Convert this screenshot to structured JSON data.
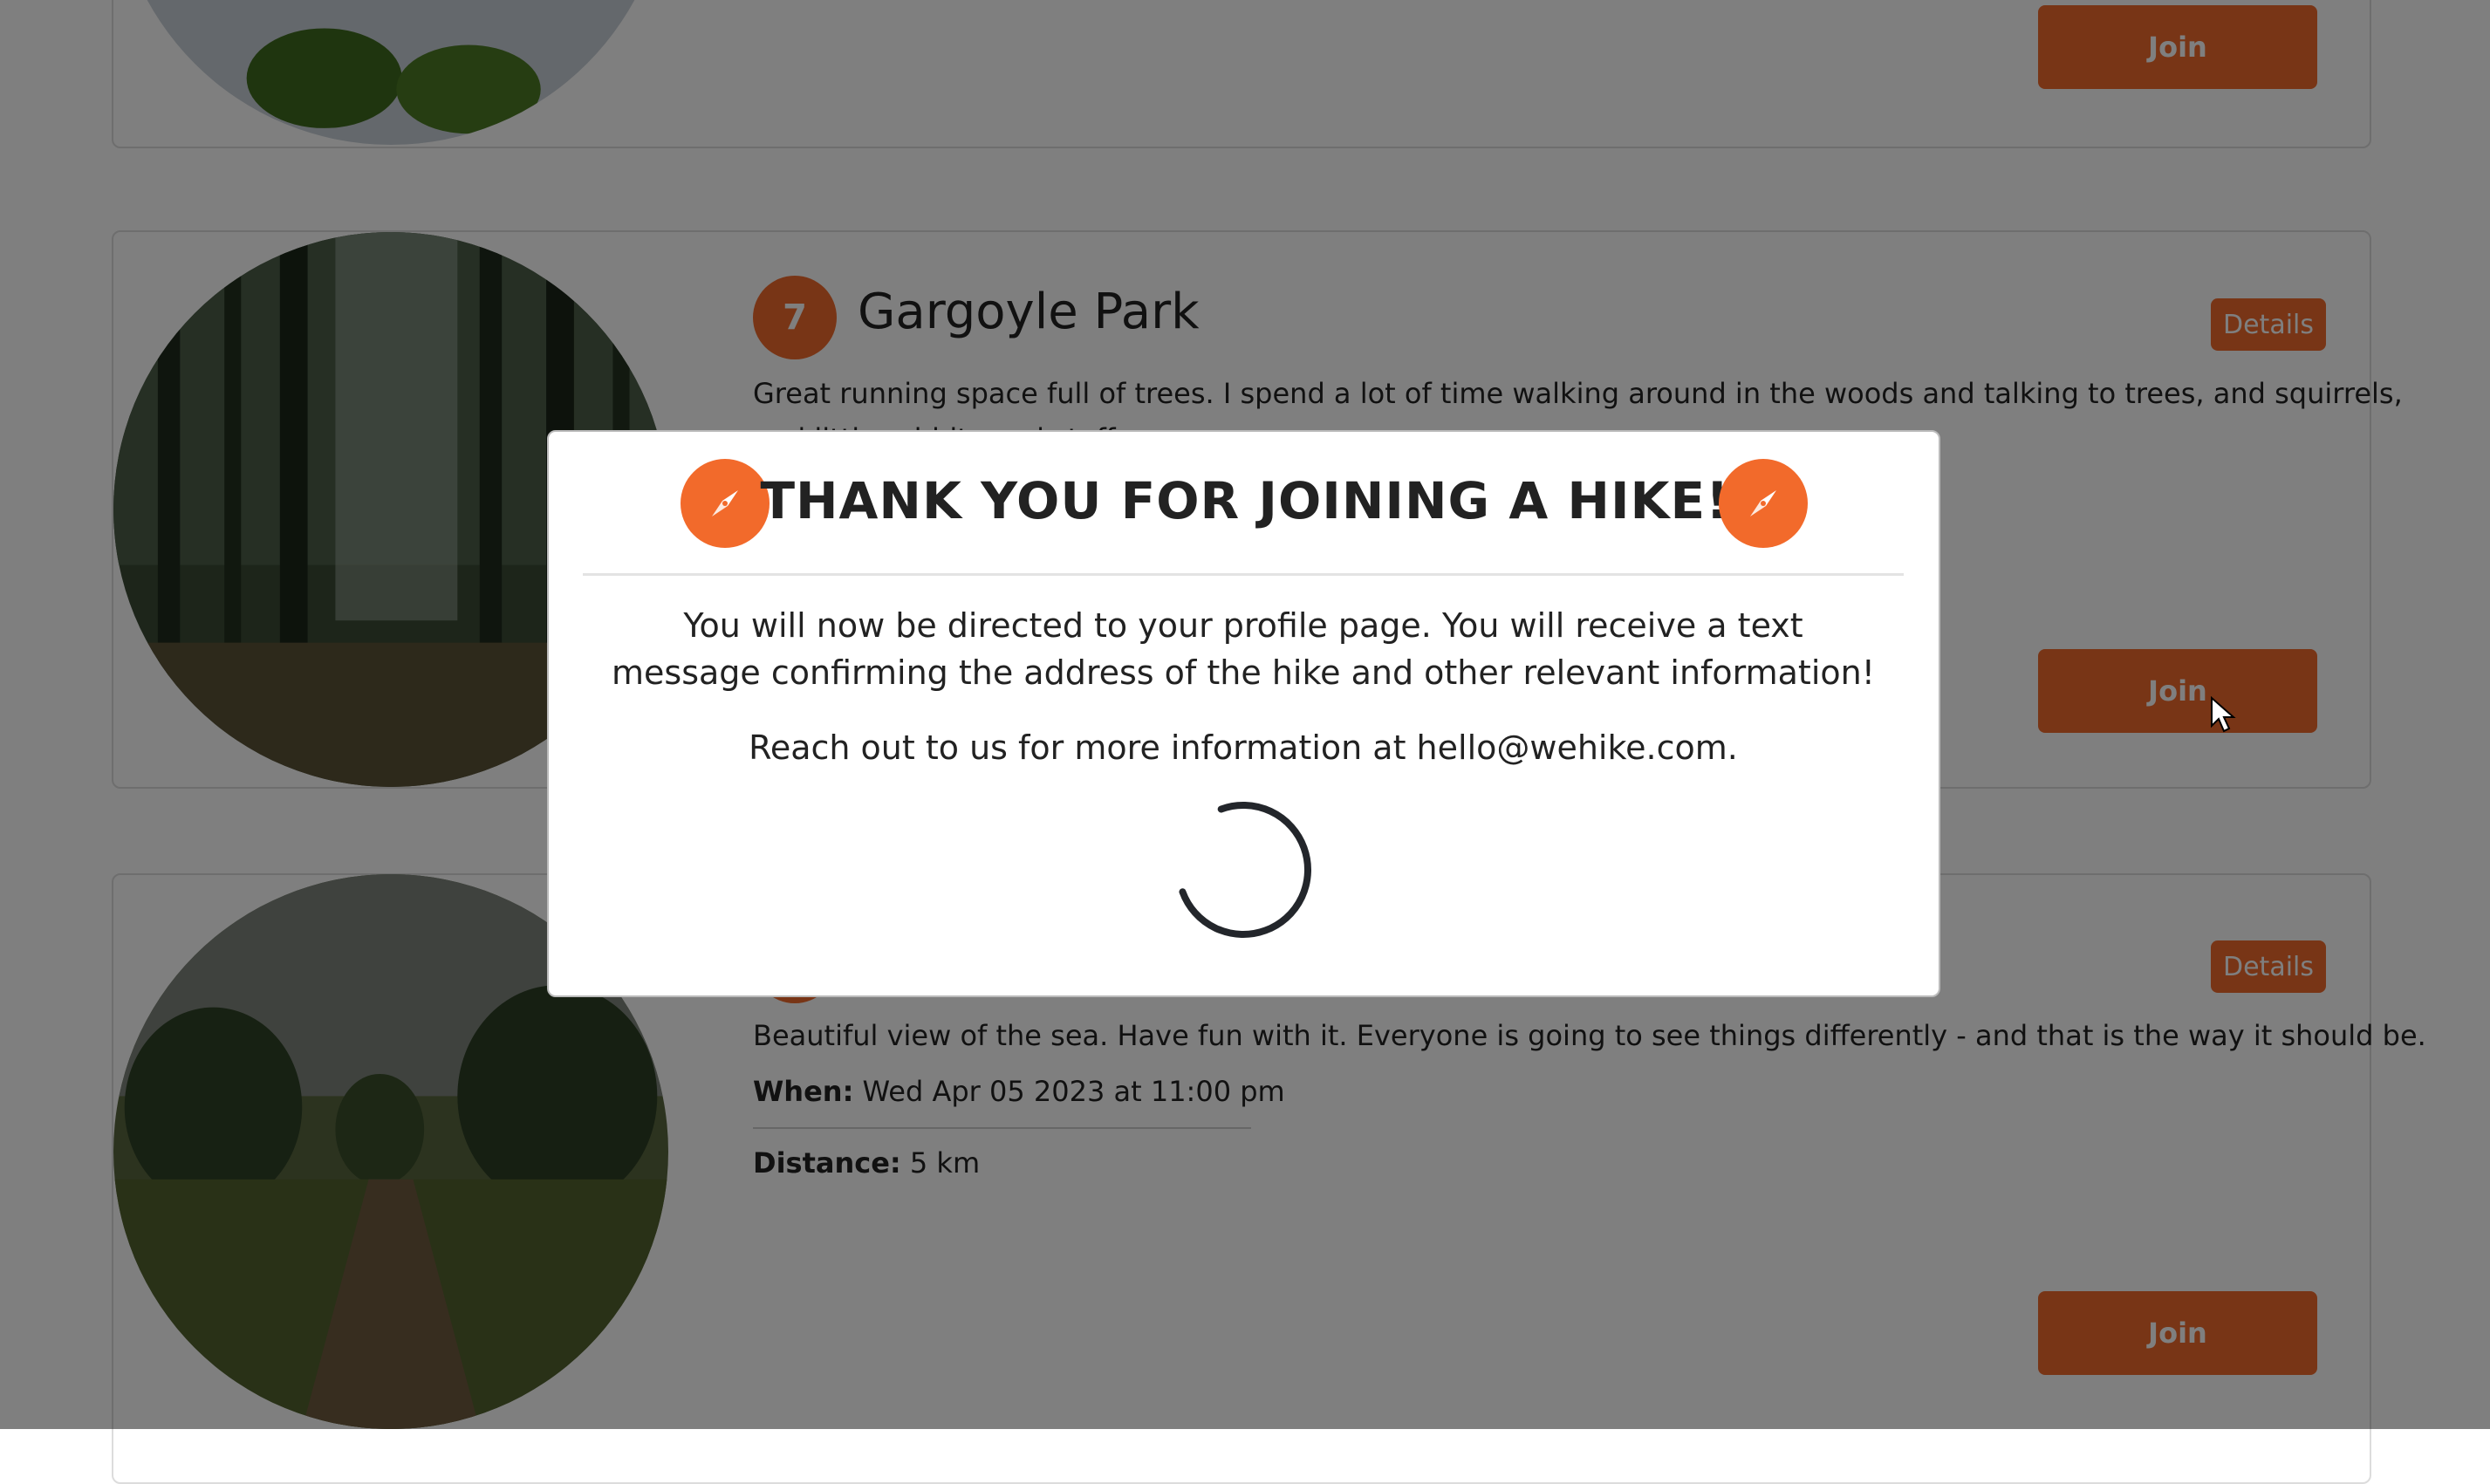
{
  "colors": {
    "accent": "#f06a2c",
    "overlay": "rgba(0,0,0,0.5)"
  },
  "hikes": [
    {
      "join_label": "Join"
    },
    {
      "number": "7",
      "title": "Gargoyle Park",
      "description": "Great running space full of trees. I spend a lot of time walking around in the woods and talking to trees, and squirrels,",
      "description_cont": "and little rabbits and stuff.",
      "details_label": "Details",
      "join_label": "Join"
    },
    {
      "description": "Beautiful view of the sea. Have fun with it. Everyone is going to see things differently - and that is the way it should be.",
      "when_label": "When:",
      "when_value": "Wed Apr 05 2023 at 11:00 pm",
      "distance_label": "Distance:",
      "distance_value": "5 km",
      "details_label": "Details",
      "join_label": "Join"
    }
  ],
  "modal": {
    "title": "THANK YOU FOR JOINING A HIKE!",
    "message": "You will now be directed to your profile page. You will receive a text message confirming the address of the hike and other relevant information!",
    "contact": "Reach out to us for more information at hello@wehike.com.",
    "icon": "compass-icon",
    "loading": true
  }
}
